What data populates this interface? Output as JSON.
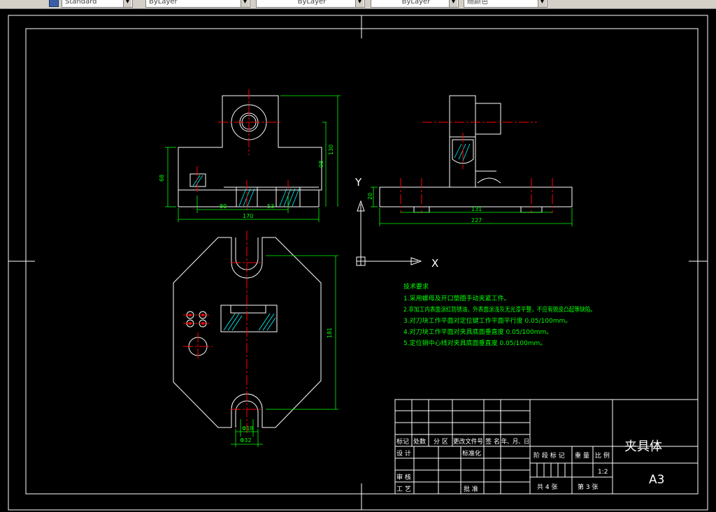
{
  "toolbar": {
    "text_style": "Standard",
    "layer": "ByLayer",
    "linetype": "ByLayer",
    "lineweight": "ByLayer",
    "color": "随颜色"
  },
  "dimensions": {
    "d130": "130",
    "d98": "98",
    "d68": "68",
    "d80": "80",
    "d53": "53",
    "d170": "170",
    "d20": "20",
    "d131": "131",
    "d227": "227",
    "d181": "181",
    "d18": "Φ18",
    "d32": "Φ32"
  },
  "ucs": {
    "x_label": "X",
    "y_label": "Y"
  },
  "notes": {
    "title": "技术要求",
    "lines": [
      "1.采用螺母及开口垫圈手动夹紧工件。",
      "2.非加工内表面涂红防锈油，外表面涂浅灰无光漆平整，不应有脱皮凸起等缺陷。",
      "3.对刀块工作平面对定位键工作平面平行度 0.05/100mm。",
      "4.对刀块工作平面对夹具底面垂直度 0.05/100mm。",
      "5.定位销中心线对夹具底面垂直度 0.05/100mm。"
    ]
  },
  "title_block": {
    "h_marker": "标记",
    "h_count": "处数",
    "h_zone": "分 区",
    "h_docno": "更改文件号",
    "h_sign": "签 名",
    "h_date": "年、月、日",
    "design": "设 计",
    "standard": "标准化",
    "stage": "阶 段 标 记",
    "weight": "重 量",
    "scale_label": "比 例",
    "scale_value": "1:2",
    "check": "审 核",
    "process": "工 艺",
    "approve": "批 准",
    "sheets": "共 4 张",
    "sheet_no": "第 3 张",
    "name": "夹具体",
    "size": "A3"
  },
  "colors": {
    "outline": "#ffffff",
    "centerline": "#ff0000",
    "dimension": "#00ff00",
    "hatch": "#00ffff"
  }
}
